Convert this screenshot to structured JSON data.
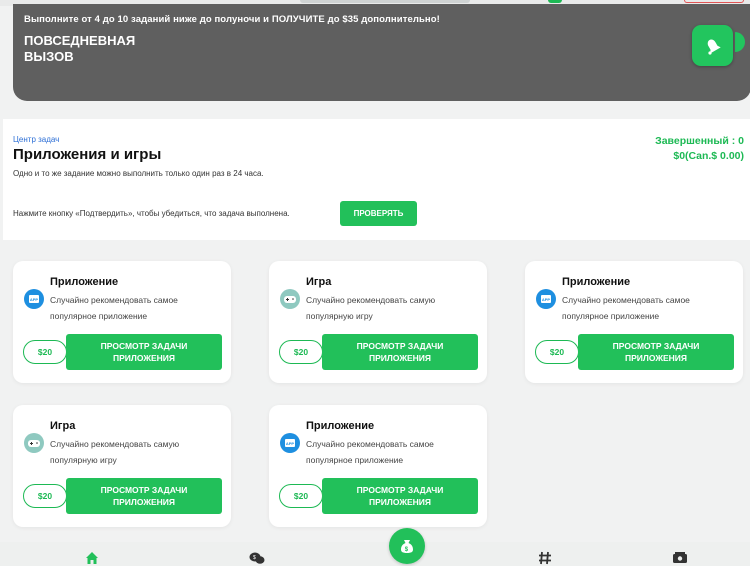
{
  "banner": {
    "promo": "Выполните от 4 до 10 заданий ниже до полуночи и ПОЛУЧИТЕ до $35 дополнительно!",
    "title": "ПОВСЕДНЕВНАЯ ВЫЗОВ",
    "badge_icon": "bell-icon"
  },
  "task_center": {
    "kicker": "Центр задач",
    "heading": "Приложения и игры",
    "note": "Одно и то же задание можно выполнить только один раз в 24 часа.",
    "completed": "Завершенный : 0",
    "earned": "$0(Can.$ 0.00)",
    "confirm_hint": "Нажмите кнопку «Подтвердить», чтобы убедиться, что задача выполнена.",
    "verify_label": "ПРОВЕРЯТЬ"
  },
  "cards": [
    {
      "type": "app",
      "title": "Приложение",
      "desc": "Случайно рекомендовать самое популярное приложение",
      "reward": "$20",
      "button": "ПРОСМОТР ЗАДАЧИ ПРИЛОЖЕНИЯ"
    },
    {
      "type": "game",
      "title": "Игра",
      "desc": "Случайно рекомендовать самую популярную игру",
      "reward": "$20",
      "button": "ПРОСМОТР ЗАДАЧИ ПРИЛОЖЕНИЯ"
    },
    {
      "type": "app",
      "title": "Приложение",
      "desc": "Случайно рекомендовать самое популярное приложение",
      "reward": "$20",
      "button": "ПРОСМОТР ЗАДАЧИ ПРИЛОЖЕНИЯ"
    },
    {
      "type": "game",
      "title": "Игра",
      "desc": "Случайно рекомендовать самую популярную игру",
      "reward": "$20",
      "button": "ПРОСМОТР ЗАДАЧИ ПРИЛОЖЕНИЯ"
    },
    {
      "type": "app",
      "title": "Приложение",
      "desc": "Случайно рекомендовать самое популярное приложение",
      "reward": "$20",
      "button": "ПРОСМОТР ЗАДАЧИ ПРИЛОЖЕНИЯ"
    }
  ],
  "bottom_nav": {
    "items": [
      "home-icon",
      "chat-icon",
      "money-bag-icon",
      "hashtag-icon",
      "ticket-icon"
    ]
  },
  "colors": {
    "accent": "#22c05a",
    "banner_bg": "#5f5f5f",
    "link_blue": "#2d6fd6"
  }
}
